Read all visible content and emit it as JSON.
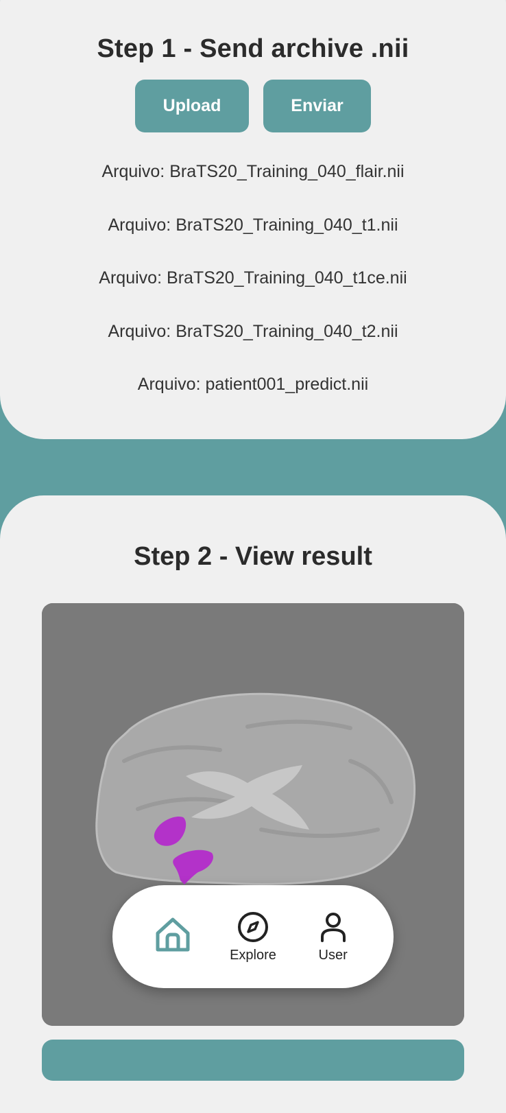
{
  "theme": {
    "accent": "#5f9ea0",
    "card_bg": "#f0f0f0",
    "text": "#2b2b2b",
    "segmentation_color": "#b332c9"
  },
  "step1": {
    "title": "Step 1 - Send archive .nii",
    "upload_label": "Upload",
    "send_label": "Enviar",
    "file_prefix": "Arquivo:",
    "files": [
      "BraTS20_Training_040_flair.nii",
      "BraTS20_Training_040_t1.nii",
      "BraTS20_Training_040_t1ce.nii",
      "BraTS20_Training_040_t2.nii",
      "patient001_predict.nii"
    ]
  },
  "step2": {
    "title": "Step 2 - View result",
    "image_icon": "brain-mri-slice"
  },
  "nav": {
    "items": [
      {
        "icon": "home-icon",
        "label": "",
        "active": true
      },
      {
        "icon": "compass-icon",
        "label": "Explore",
        "active": false
      },
      {
        "icon": "user-icon",
        "label": "User",
        "active": false
      }
    ]
  }
}
